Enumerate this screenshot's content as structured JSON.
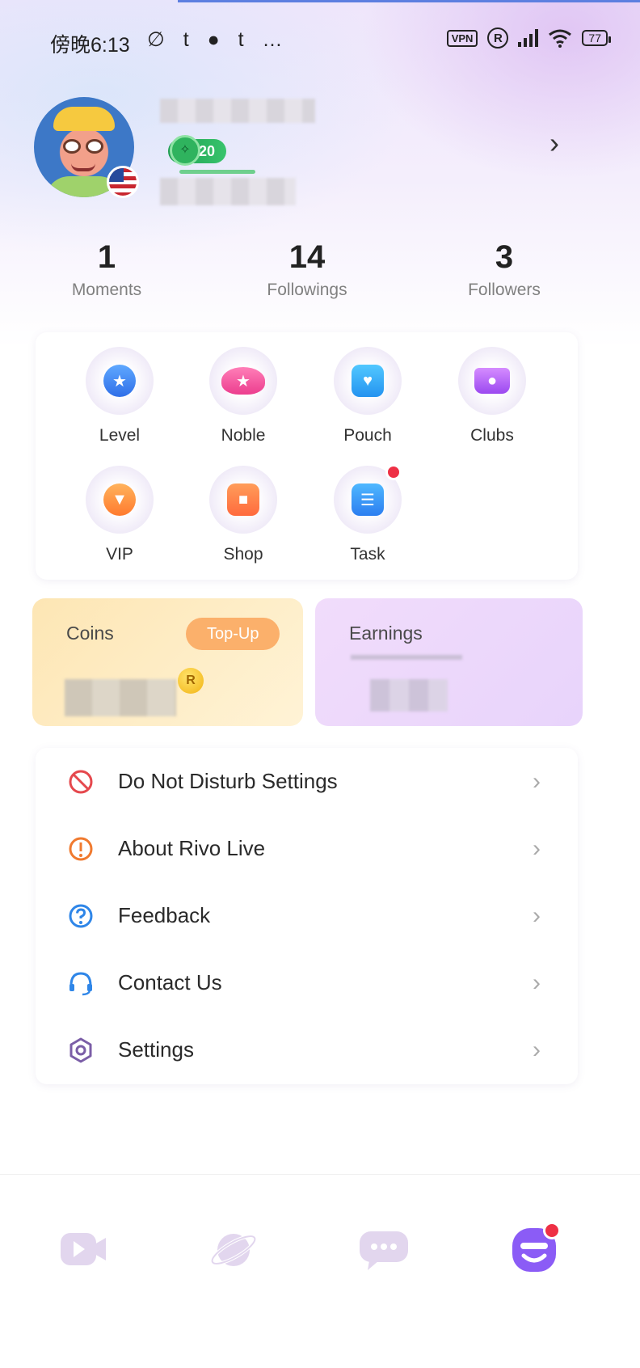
{
  "status_bar": {
    "time": "傍晚6:13",
    "left_icons": "∅ t ● t …",
    "vpn": "VPN",
    "reg": "R",
    "battery": "77"
  },
  "profile": {
    "level": "20"
  },
  "stats": [
    {
      "value": "1",
      "label": "Moments"
    },
    {
      "value": "14",
      "label": "Followings"
    },
    {
      "value": "3",
      "label": "Followers"
    }
  ],
  "features": [
    {
      "label": "Level",
      "icon": "medal-icon"
    },
    {
      "label": "Noble",
      "icon": "wings-icon"
    },
    {
      "label": "Pouch",
      "icon": "bag-icon"
    },
    {
      "label": "Clubs",
      "icon": "crown-icon"
    },
    {
      "label": "VIP",
      "icon": "diamond-icon"
    },
    {
      "label": "Shop",
      "icon": "store-icon"
    },
    {
      "label": "Task",
      "icon": "clipboard-icon"
    }
  ],
  "wallet": {
    "coins_label": "Coins",
    "topup_label": "Top-Up",
    "coin_symbol": "R",
    "earnings_label": "Earnings"
  },
  "menu": [
    {
      "label": "Do Not Disturb Settings",
      "icon": "no-disturb-icon"
    },
    {
      "label": "About Rivo Live",
      "icon": "info-icon"
    },
    {
      "label": "Feedback",
      "icon": "question-icon"
    },
    {
      "label": "Contact Us",
      "icon": "headset-icon"
    },
    {
      "label": "Settings",
      "icon": "gear-icon"
    }
  ],
  "colors": {
    "accent_purple": "#8b5cf6",
    "topup_orange": "#fbb06b",
    "badge_green": "#2fb35e",
    "notification_red": "#ee3045"
  }
}
